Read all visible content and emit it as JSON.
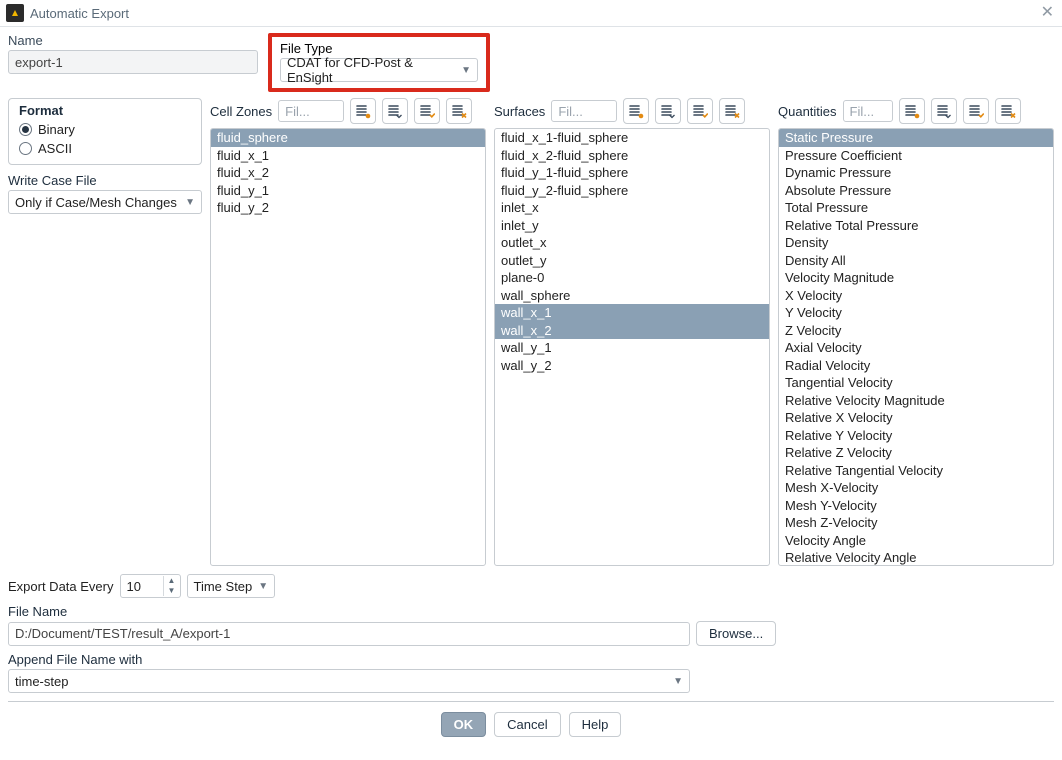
{
  "window": {
    "title": "Automatic Export"
  },
  "top": {
    "name_label": "Name",
    "name_value": "export-1",
    "filetype_label": "File Type",
    "filetype_value": "CDAT for CFD-Post & EnSight"
  },
  "sidebar": {
    "format_title": "Format",
    "format_binary": "Binary",
    "format_ascii": "ASCII",
    "write_case_label": "Write Case File",
    "write_case_value": "Only if Case/Mesh Changes"
  },
  "panels": {
    "cell_zones": {
      "label": "Cell Zones",
      "filter_ph": "Fil...",
      "items": [
        "fluid_sphere",
        "fluid_x_1",
        "fluid_x_2",
        "fluid_y_1",
        "fluid_y_2"
      ],
      "selected": [
        "fluid_sphere"
      ]
    },
    "surfaces": {
      "label": "Surfaces",
      "filter_ph": "Fil...",
      "items": [
        "fluid_x_1-fluid_sphere",
        "fluid_x_2-fluid_sphere",
        "fluid_y_1-fluid_sphere",
        "fluid_y_2-fluid_sphere",
        "inlet_x",
        "inlet_y",
        "outlet_x",
        "outlet_y",
        "plane-0",
        "wall_sphere",
        "wall_x_1",
        "wall_x_2",
        "wall_y_1",
        "wall_y_2"
      ],
      "selected": [
        "wall_x_1",
        "wall_x_2"
      ]
    },
    "quantities": {
      "label": "Quantities",
      "filter_ph": "Fil...",
      "items": [
        "Static Pressure",
        "Pressure Coefficient",
        "Dynamic Pressure",
        "Absolute Pressure",
        "Total Pressure",
        "Relative Total Pressure",
        "Density",
        "Density All",
        "Velocity Magnitude",
        "X Velocity",
        "Y Velocity",
        "Z Velocity",
        "Axial Velocity",
        "Radial Velocity",
        "Tangential Velocity",
        "Relative Velocity Magnitude",
        "Relative X Velocity",
        "Relative Y Velocity",
        "Relative Z Velocity",
        "Relative Tangential Velocity",
        "Mesh X-Velocity",
        "Mesh Y-Velocity",
        "Mesh Z-Velocity",
        "Velocity Angle",
        "Relative Velocity Angle"
      ],
      "selected": [
        "Static Pressure"
      ]
    }
  },
  "bottom": {
    "export_every_label": "Export Data Every",
    "export_every_value": "10",
    "export_every_unit": "Time Step",
    "file_name_label": "File Name",
    "file_name_value": "D:/Document/TEST/result_A/export-1",
    "browse_label": "Browse...",
    "append_label": "Append File Name with",
    "append_value": "time-step"
  },
  "footer": {
    "ok": "OK",
    "cancel": "Cancel",
    "help": "Help"
  }
}
